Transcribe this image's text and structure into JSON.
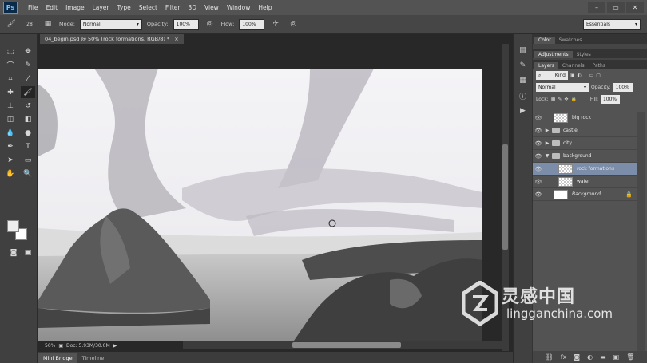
{
  "app": {
    "logo": "Ps"
  },
  "menu": [
    "File",
    "Edit",
    "Image",
    "Layer",
    "Type",
    "Select",
    "Filter",
    "3D",
    "View",
    "Window",
    "Help"
  ],
  "window_controls": [
    "–",
    "▭",
    "✕"
  ],
  "options": {
    "brush_size": "28",
    "mode_label": "Mode:",
    "mode_value": "Normal",
    "opacity_label": "Opacity:",
    "opacity_value": "100%",
    "flow_label": "Flow:",
    "flow_value": "100%",
    "workspace": "Essentials"
  },
  "document": {
    "tab_title": "04_begin.psd @ 50% (rock formations, RGB/8) *",
    "tab_close": "×",
    "zoom": "50%",
    "doc_info": "Doc: 5.93M/30.0M"
  },
  "bottom_tabs": [
    "Mini Bridge",
    "Timeline"
  ],
  "panels": {
    "top_tabs": [
      "Color",
      "Swatches"
    ],
    "mid_tabs": [
      "Adjustments",
      "Styles"
    ],
    "layer_tabs": [
      "Layers",
      "Channels",
      "Paths"
    ],
    "kind_label": "Kind",
    "blend_mode": "Normal",
    "opacity_label": "Opacity:",
    "opacity_value": "100%",
    "lock_label": "Lock:",
    "fill_label": "Fill:",
    "fill_value": "100%"
  },
  "layers": [
    {
      "name": "big rock",
      "kind": "layer",
      "selected": false
    },
    {
      "name": "castle",
      "kind": "group",
      "selected": false
    },
    {
      "name": "city",
      "kind": "group",
      "selected": false
    },
    {
      "name": "background",
      "kind": "group-open",
      "selected": false
    },
    {
      "name": "rock formations",
      "kind": "layer-child",
      "selected": true
    },
    {
      "name": "water",
      "kind": "layer-child",
      "selected": false
    },
    {
      "name": "Background",
      "kind": "background",
      "selected": false
    }
  ],
  "watermark": {
    "cn": "灵感中国",
    "en": "lingganchina.com"
  },
  "colors": {
    "menubar": "#535353",
    "selection": "#7b8da8",
    "accent": "#34a3ff"
  }
}
